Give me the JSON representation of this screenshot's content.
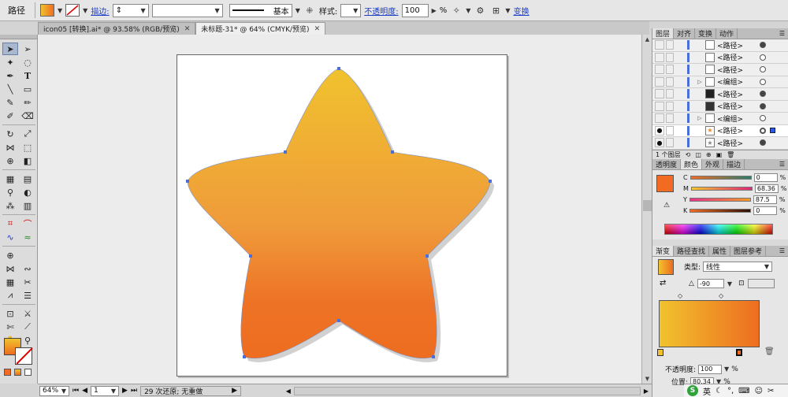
{
  "control_bar": {
    "object_label": "路径",
    "fill_color": "#ee8a2a",
    "stroke_label": "描边:",
    "stroke_profile": "基本",
    "style_label": "样式:",
    "opacity_label": "不透明度:",
    "opacity_value": "100",
    "opacity_unit": "%",
    "transform_label": "变换"
  },
  "document_tabs": [
    {
      "title": "icon05 [转换].ai* @ 93.58% (RGB/预览)",
      "active": false
    },
    {
      "title": "未标题-31* @ 64% (CMYK/预览)",
      "active": true
    }
  ],
  "status_bar": {
    "zoom": "64%",
    "artboard": "1",
    "history": "29 次还原; 无重做"
  },
  "layers_panel": {
    "tabs": [
      "图层",
      "对齐",
      "变换",
      "动作"
    ],
    "rows": [
      {
        "name": "<路径>",
        "expandable": false,
        "target_filled": true,
        "visible": false
      },
      {
        "name": "<路径>",
        "expandable": false,
        "target_filled": false,
        "visible": false
      },
      {
        "name": "<路径>",
        "expandable": false,
        "target_filled": false,
        "visible": false
      },
      {
        "name": "<编组>",
        "expandable": true,
        "target_filled": false,
        "visible": false
      },
      {
        "name": "<路径>",
        "expandable": false,
        "target_filled": true,
        "visible": false
      },
      {
        "name": "<路径>",
        "expandable": false,
        "target_filled": true,
        "visible": false
      },
      {
        "name": "<编组>",
        "expandable": true,
        "target_filled": false,
        "visible": false
      },
      {
        "name": "<路径>",
        "expandable": false,
        "target_filled": false,
        "visible": true,
        "selected": true
      },
      {
        "name": "<路径>",
        "expandable": false,
        "target_filled": true,
        "visible": true
      }
    ],
    "footer_count": "1 个图层"
  },
  "color_panel": {
    "tabs": [
      "透明度",
      "颜色",
      "外观",
      "描边"
    ],
    "swatch": "#f26b22",
    "channels": [
      {
        "label": "C",
        "value": "0",
        "gradient": "linear-gradient(90deg,#fff,#00a0e0)"
      },
      {
        "label": "M",
        "value": "68.36",
        "gradient": "linear-gradient(90deg,#fde33a,#e5277a)"
      },
      {
        "label": "Y",
        "value": "87.5",
        "gradient": "linear-gradient(90deg,#e95d95,#f39a24)"
      },
      {
        "label": "K",
        "value": "0",
        "gradient": "linear-gradient(90deg,#f26b22,#1a0d05)"
      }
    ]
  },
  "gradient_panel": {
    "tabs": [
      "渐变",
      "路径查找",
      "属性",
      "图层参考"
    ],
    "type_label": "类型:",
    "type_value": "线性",
    "angle": "-90",
    "opacity_label": "不透明度:",
    "opacity_value": "100",
    "position_label": "位置:",
    "position_value": "80.34",
    "unit": "%",
    "stop_colors": [
      "#f1c22e",
      "#ee6d20"
    ]
  },
  "ime_bar": {
    "logo": "S",
    "lang": "英"
  }
}
